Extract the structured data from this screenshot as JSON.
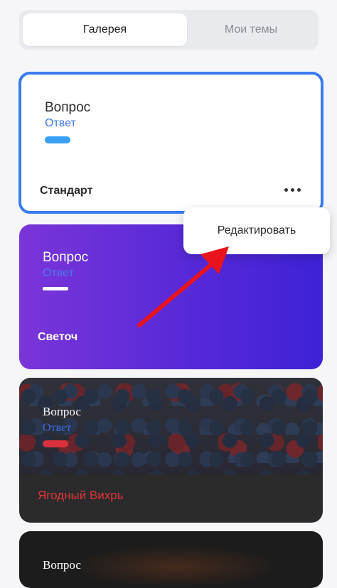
{
  "tabs": [
    {
      "label": "Галерея",
      "active": true
    },
    {
      "label": "Мои темы",
      "active": false
    }
  ],
  "cards": [
    {
      "question": "Вопрос",
      "answer": "Ответ",
      "name": "Стандарт",
      "selected": true,
      "accent": "#3a7bf0"
    },
    {
      "question": "Вопрос",
      "answer": "Ответ",
      "name": "Светоч",
      "accent": "#6b30d8"
    },
    {
      "question": "Вопрос",
      "answer": "Ответ",
      "name": "Ягодный Вихрь",
      "accent": "#e0333d"
    },
    {
      "question": "Вопрос"
    }
  ],
  "more_icon": "more-horizontal-icon",
  "context_menu": {
    "items": [
      {
        "label": "Редактировать"
      }
    ]
  },
  "annotation_arrow": {
    "color": "#e8131c"
  }
}
